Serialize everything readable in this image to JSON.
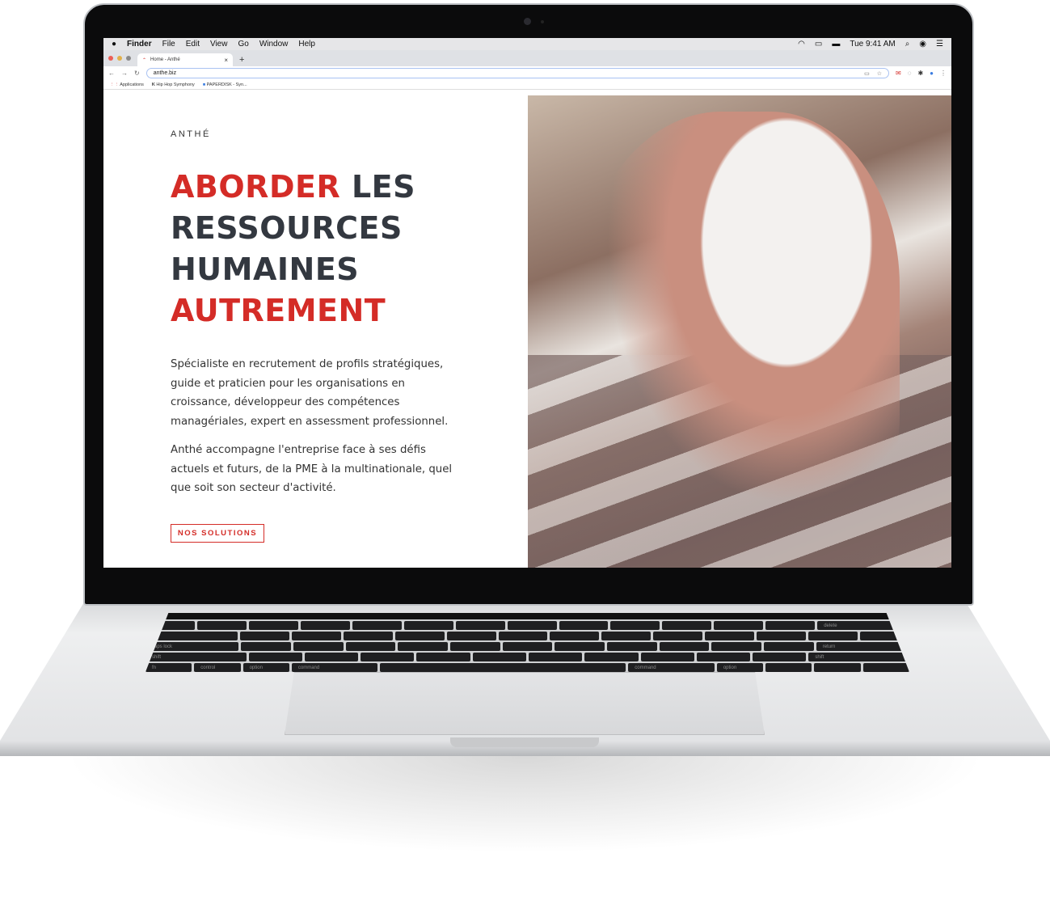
{
  "menubar": {
    "apple": "",
    "app": "Finder",
    "items": [
      "File",
      "Edit",
      "View",
      "Go",
      "Window",
      "Help"
    ],
    "clock": "Tue 9:41 AM"
  },
  "browser": {
    "tab_title": "Home - Anthé",
    "tab_close": "×",
    "new_tab": "+",
    "url": "anthe.biz",
    "bookmarks": [
      "Applications",
      "Hip Hop Symphony",
      "PAPERDISK - Syn..."
    ]
  },
  "site": {
    "brand": "ANTHÉ",
    "headline": {
      "w1": "ABORDER",
      "w2": "LES",
      "w3": "RESSOURCES",
      "w4": "HUMAINES",
      "w5": "AUTREMENT"
    },
    "para1": "Spécialiste en recrutement de profils stratégiques, guide et praticien pour les organisations en croissance, développeur des compétences managériales, expert en assessment professionnel.",
    "para2": "Anthé accompagne l'entreprise face à ses défis actuels et futurs, de la PME à la multinationale, quel que soit son secteur d'activité.",
    "cta": "NOS SOLUTIONS",
    "accent": "#d42c27",
    "text_dark": "#333840"
  },
  "keyboard": {
    "tab": "tab",
    "caps": "caps lock",
    "shift": "shift",
    "fn": "fn",
    "control": "control",
    "option": "option",
    "command": "command",
    "delete": "delete",
    "return": "return",
    "shift_r": "shift"
  }
}
